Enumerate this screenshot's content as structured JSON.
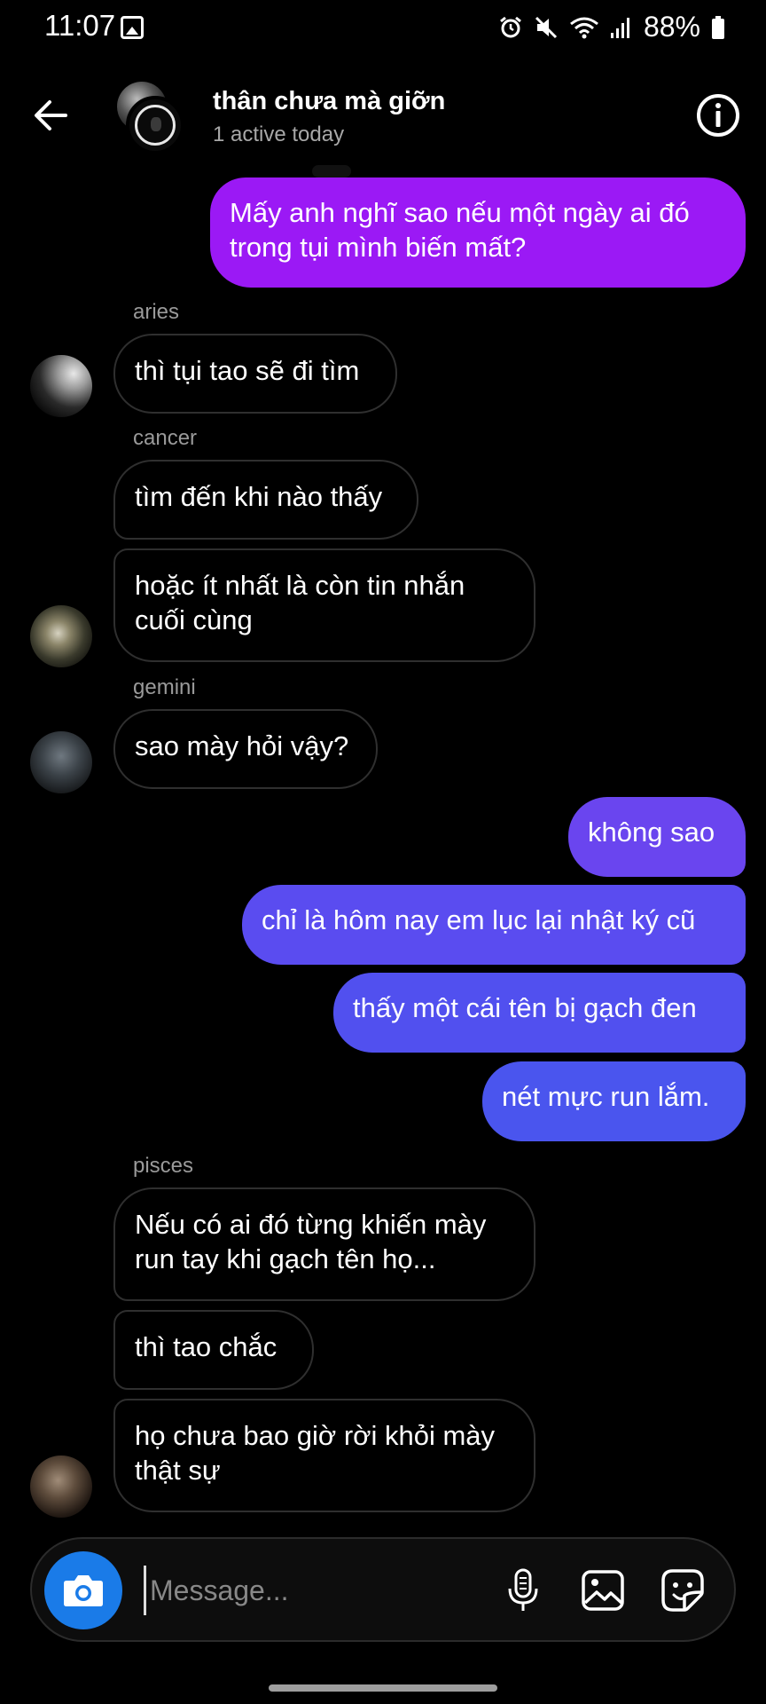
{
  "status_bar": {
    "time": "11:07",
    "battery": "88%",
    "icons": [
      "image-icon",
      "alarm-icon",
      "mute-icon",
      "wifi-icon",
      "signal-icon",
      "battery-icon"
    ]
  },
  "header": {
    "title": "thân chưa mà giỡn",
    "subtitle": "1 active today"
  },
  "messages": {
    "m0": "Mấy anh nghĩ sao nếu một ngày ai đó\ntrong tụi mình biến mất?",
    "s1": "aries",
    "m1": "thì tụi tao sẽ đi tìm",
    "s2": "cancer",
    "m2": "tìm đến khi nào thấy",
    "m3": "hoặc ít nhất là còn tin nhắn\ncuối cùng",
    "s3": "gemini",
    "m4": "sao mày hỏi vậy?",
    "m5": "không sao",
    "m6": "chỉ là hôm nay em lục lại nhật ký cũ",
    "m7": "thấy một cái tên bị gạch đen",
    "m8": "nét mực run lắm.",
    "s4": "pisces",
    "m9": "Nếu có ai đó từng khiến mày\nrun tay khi gạch tên họ...",
    "m10": "thì tao chắc",
    "m11": "họ chưa bao giờ rời khỏi mày\nthật sự"
  },
  "composer": {
    "placeholder": "Message..."
  },
  "colors": {
    "bubble_out_purple": "#9b19f5",
    "bubble_out_violet": "#6446f0",
    "bubble_out_blue": "#4a52ee",
    "camera_blue": "#1a7be8",
    "bubble_in_border": "#2f2f2f"
  }
}
